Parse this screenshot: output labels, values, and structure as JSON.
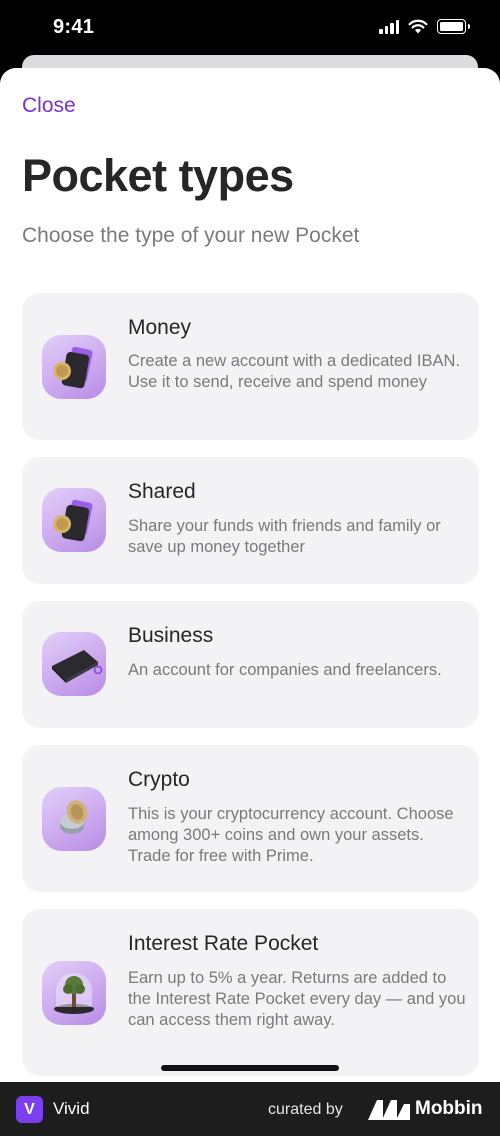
{
  "status_bar": {
    "time": "9:41"
  },
  "header": {
    "close_label": "Close",
    "title": "Pocket types",
    "subtitle": "Choose the type of your new Pocket"
  },
  "pocket_types": [
    {
      "title": "Money",
      "description": "Create a new account with a dedicated IBAN. Use it to send, receive and spend money",
      "icon": "card-coin-icon"
    },
    {
      "title": "Shared",
      "description": "Share your funds with friends and family or save up money together",
      "icon": "card-coin-icon"
    },
    {
      "title": "Business",
      "description": "An account for companies and freelancers.",
      "icon": "briefcase-icon"
    },
    {
      "title": "Crypto",
      "description": "This is your cryptocurrency account. Choose among 300+ coins and own your assets. Trade for free with Prime.",
      "icon": "crypto-coin-icon"
    },
    {
      "title": "Interest Rate Pocket",
      "description": "Earn up to 5% a year. Returns are added to the Interest Rate Pocket every day — and you can access them right away.",
      "icon": "tree-dome-icon"
    }
  ],
  "footer": {
    "app_logo_letter": "V",
    "app_name": "Vivid",
    "curated_by": "curated by",
    "brand": "Mobbin"
  },
  "colors": {
    "accent": "#7d2fe0",
    "card_bg": "#f3f3f5",
    "icon_bg": "#c9a6f0"
  }
}
